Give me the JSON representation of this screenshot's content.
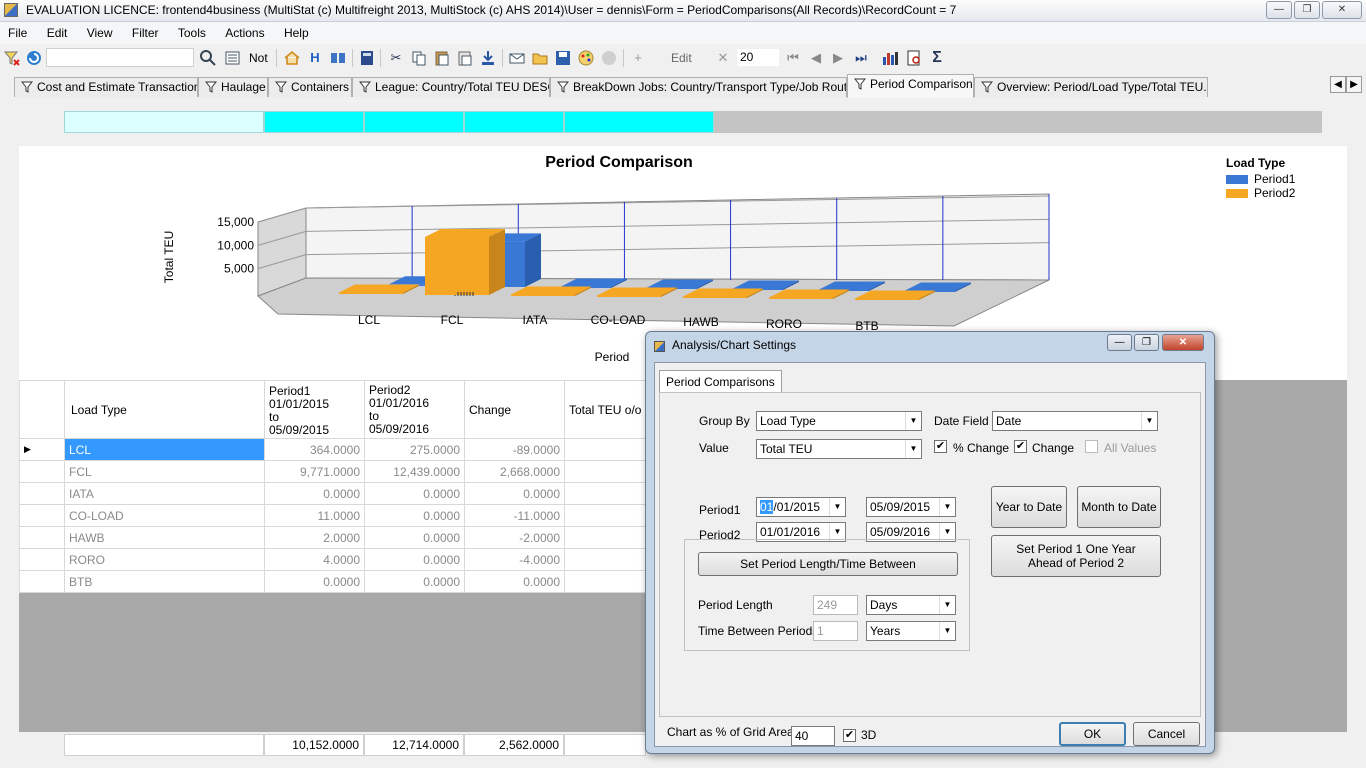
{
  "window": {
    "title": "EVALUATION LICENCE: frontend4business (MultiStat (c) Multifreight 2013, MultiStock (c) AHS 2014)\\User = dennis\\Form = PeriodComparisons(All Records)\\RecordCount = 7",
    "min_glyph": "—",
    "max_glyph": "❐",
    "close_glyph": "✕"
  },
  "menu": [
    "File",
    "Edit",
    "View",
    "Filter",
    "Tools",
    "Actions",
    "Help"
  ],
  "toolbar": {
    "not_label": "Not",
    "h_label": "H",
    "edit_label": "Edit",
    "record_value": "20",
    "sigma_label": "Σ"
  },
  "tabs": [
    "Cost and Estimate Transactions",
    "Haulage",
    "Containers",
    "League: Country/Total TEU DESC",
    "BreakDown Jobs: Country/Transport Type/Job Route...",
    "Period Comparisons",
    "Overview: Period/Load Type/Total TEU..."
  ],
  "tab_arrows": [
    "◀",
    "▶"
  ],
  "chart_data": {
    "type": "bar",
    "title": "Period Comparison",
    "ylabel": "Total TEU",
    "xlabel": "Period",
    "legend_title": "Load Type",
    "legend_position": "top-right",
    "three_d": true,
    "ylim": [
      0,
      15000
    ],
    "yticks": [
      "15,000",
      "10,000",
      "5,000"
    ],
    "categories": [
      "LCL",
      "FCL",
      "IATA",
      "CO-LOAD",
      "HAWB",
      "RORO",
      "BTB"
    ],
    "series": [
      {
        "name": "Period1",
        "color": "#3a78d6",
        "values": [
          364,
          9771,
          0,
          11,
          2,
          4,
          0
        ]
      },
      {
        "name": "Period2",
        "color": "#f5a623",
        "values": [
          275,
          12439,
          0,
          0,
          0,
          0,
          0
        ]
      }
    ]
  },
  "grid": {
    "headers": {
      "load_type": "Load Type",
      "p1_name": "Period1",
      "p1_from": "01/01/2015",
      "p1_to_word": "to",
      "p1_to": "05/09/2015",
      "p2_name": "Period2",
      "p2_from": "01/01/2016",
      "p2_to_word": "to",
      "p2_to": "05/09/2016",
      "change": "Change",
      "total": "Total TEU o/o"
    },
    "current_row_marker": "▶",
    "rows": [
      {
        "type": "LCL",
        "p1": "364.0000",
        "p2": "275.0000",
        "change": "-89.0000"
      },
      {
        "type": "FCL",
        "p1": "9,771.0000",
        "p2": "12,439.0000",
        "change": "2,668.0000"
      },
      {
        "type": "IATA",
        "p1": "0.0000",
        "p2": "0.0000",
        "change": "0.0000"
      },
      {
        "type": "CO-LOAD",
        "p1": "11.0000",
        "p2": "0.0000",
        "change": "-11.0000"
      },
      {
        "type": "HAWB",
        "p1": "2.0000",
        "p2": "0.0000",
        "change": "-2.0000"
      },
      {
        "type": "RORO",
        "p1": "4.0000",
        "p2": "0.0000",
        "change": "-4.0000"
      },
      {
        "type": "BTB",
        "p1": "0.0000",
        "p2": "0.0000",
        "change": "0.0000"
      }
    ],
    "totals": {
      "p1": "10,152.0000",
      "p2": "12,714.0000",
      "change": "2,562.0000"
    }
  },
  "dialog": {
    "title": "Analysis/Chart Settings",
    "tab": "Period Comparisons",
    "group_by_label": "Group By",
    "group_by_value": "Load Type",
    "date_field_label": "Date Field",
    "date_field_value": "Date",
    "value_label": "Value",
    "value_value": "Total TEU",
    "pct_change_label": "% Change",
    "pct_change_checked": true,
    "change_label": "Change",
    "change_checked": true,
    "all_values_label": "All Values",
    "all_values_checked": false,
    "period1_label": "Period1",
    "period1_from_selected": "01",
    "period1_from_rest": "/01/2015",
    "period1_to": "05/09/2015",
    "period2_label": "Period2",
    "period2_from": "01/01/2016",
    "period2_to": "05/09/2016",
    "year_to_date": "Year to Date",
    "month_to_date": "Month to Date",
    "set_p1_ahead": "Set Period 1 One Year Ahead of Period 2",
    "set_period_length": "Set Period Length/Time Between",
    "period_length_label": "Period Length",
    "period_length_value": "249",
    "period_length_unit": "Days",
    "time_between_label": "Time Between Periods",
    "time_between_value": "1",
    "time_between_unit": "Years",
    "chart_pct_label": "Chart as % of Grid Area",
    "chart_pct_value": "40",
    "three_d_label": "3D",
    "three_d_checked": true,
    "ok": "OK",
    "cancel": "Cancel",
    "check_mark": "✔",
    "drop_arrow": "▼"
  }
}
